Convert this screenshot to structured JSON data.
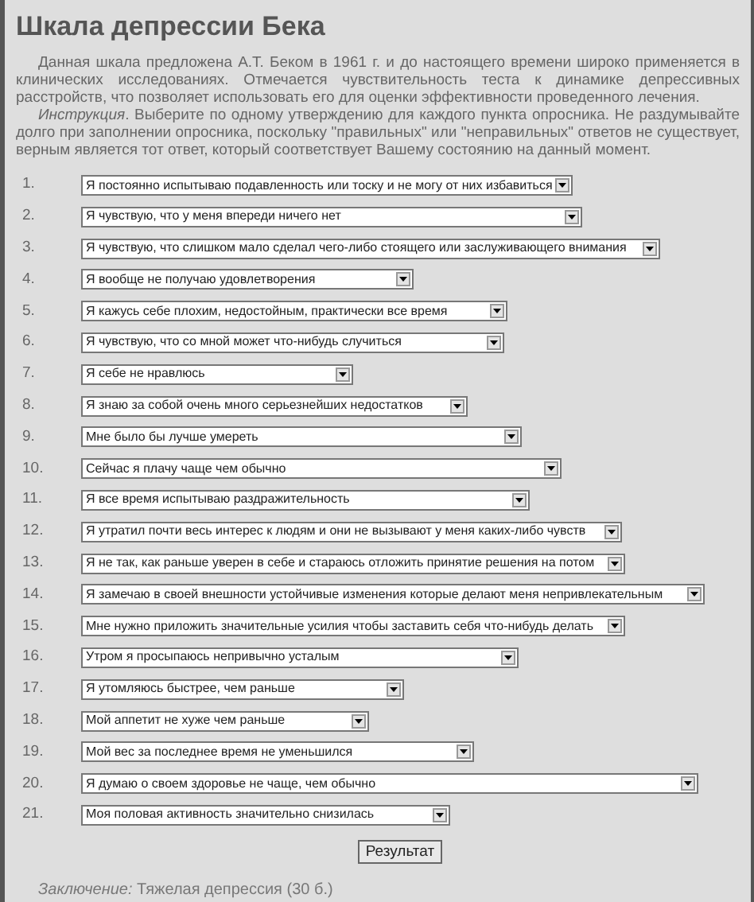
{
  "title": "Шкала депрессии Бека",
  "paragraphs": [
    "Данная шкала предложена А.Т. Беком в 1961 г. и до настоящего времени широко применяется в клинических исследованиях. Отмечается чувствительность теста к динамике депрессивных расстройств, что позволяет использовать его для оценки эффективности проведенного лечения.",
    "*Инструкция*. Выберите по одному утверждению для каждого пункта опросника. Не раздумывайте долго при заполнении опросника, поскольку \"правильных\" или \"неправильных\" ответов не существует, верным является тот ответ, который соответствует Вашему состоянию на данный момент."
  ],
  "questions": [
    {
      "number": "1.",
      "value": "Я постоянно испытываю подавленность или тоску и не могу от них избавиться"
    },
    {
      "number": "2.",
      "value": "Я чувствую, что у меня впереди ничего нет"
    },
    {
      "number": "3.",
      "value": "Я чувствую, что слишком мало сделал чего-либо стоящего или заслуживающего внимания"
    },
    {
      "number": "4.",
      "value": "Я вообще не получаю удовлетворения"
    },
    {
      "number": "5.",
      "value": "Я кажусь себе плохим, недостойным, практически все время"
    },
    {
      "number": "6.",
      "value": "Я чувствую, что со мной может что-нибудь случиться"
    },
    {
      "number": "7.",
      "value": "Я себе не нравлюсь"
    },
    {
      "number": "8.",
      "value": "Я знаю за собой очень много серьезнейших недостатков"
    },
    {
      "number": "9.",
      "value": "Мне было бы лучше умереть"
    },
    {
      "number": "10.",
      "value": "Сейчас я плачу чаще чем обычно"
    },
    {
      "number": "11.",
      "value": "Я все время испытываю раздражительность"
    },
    {
      "number": "12.",
      "value": "Я утратил почти весь интерес к людям и они не вызывают у меня каких-либо чувств"
    },
    {
      "number": "13.",
      "value": "Я не так, как раньше уверен в себе и стараюсь отложить принятие решения на потом"
    },
    {
      "number": "14.",
      "value": "Я замечаю в своей внешности устойчивые изменения которые делают меня непривлекательным"
    },
    {
      "number": "15.",
      "value": "Мне нужно приложить значительные усилия чтобы заставить себя что-нибудь делать"
    },
    {
      "number": "16.",
      "value": "Утром я просыпаюсь непривычно усталым"
    },
    {
      "number": "17.",
      "value": "Я утомляюсь быстрее, чем раньше"
    },
    {
      "number": "18.",
      "value": "Мой аппетит не хуже чем раньше"
    },
    {
      "number": "19.",
      "value": "Мой вес за последнее время не уменьшился"
    },
    {
      "number": "20.",
      "value": "Я думаю о своем здоровье не чаще, чем обычно"
    },
    {
      "number": "21.",
      "value": "Моя половая активность значительно снизилась"
    }
  ],
  "submit_button": "Результат",
  "conclusion": "*Заключение:* Тяжелая депрессия (30 б.)"
}
